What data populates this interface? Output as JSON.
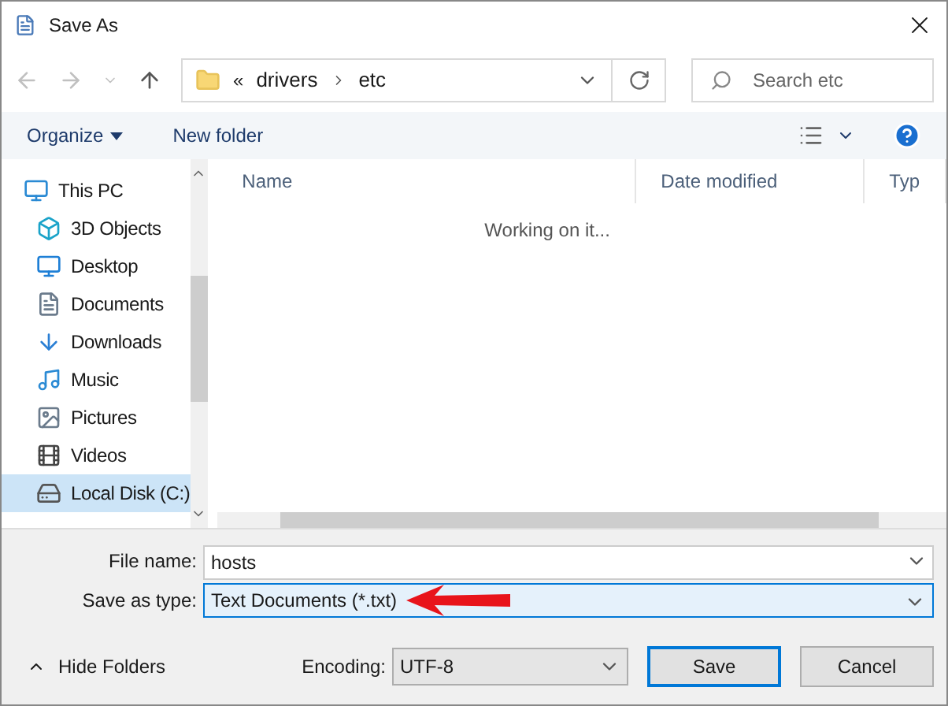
{
  "window": {
    "title": "Save As"
  },
  "address": {
    "crumbs": [
      "drivers",
      "etc"
    ],
    "overflow": "«"
  },
  "search": {
    "placeholder": "Search etc"
  },
  "toolbar": {
    "organize": "Organize",
    "new_folder": "New folder"
  },
  "sidebar": {
    "items": [
      {
        "label": "This PC",
        "selected": false,
        "children": [
          {
            "label": "3D Objects",
            "selected": false
          },
          {
            "label": "Desktop",
            "selected": false
          },
          {
            "label": "Documents",
            "selected": false
          },
          {
            "label": "Downloads",
            "selected": false
          },
          {
            "label": "Music",
            "selected": false
          },
          {
            "label": "Pictures",
            "selected": false
          },
          {
            "label": "Videos",
            "selected": false
          },
          {
            "label": "Local Disk (C:)",
            "selected": true
          }
        ]
      }
    ]
  },
  "table": {
    "columns": [
      "Name",
      "Date modified",
      "Typ"
    ],
    "status": "Working on it..."
  },
  "form": {
    "file_name_label": "File name:",
    "file_name": "hosts",
    "type_label": "Save as type:",
    "type_value": "Text Documents (*.txt)"
  },
  "footer": {
    "hide_folders": "Hide Folders",
    "encoding_label": "Encoding:",
    "encoding": "UTF-8",
    "buttons": [
      {
        "label": "Save",
        "kind": "primary"
      },
      {
        "label": "Cancel",
        "kind": "normal"
      }
    ]
  }
}
